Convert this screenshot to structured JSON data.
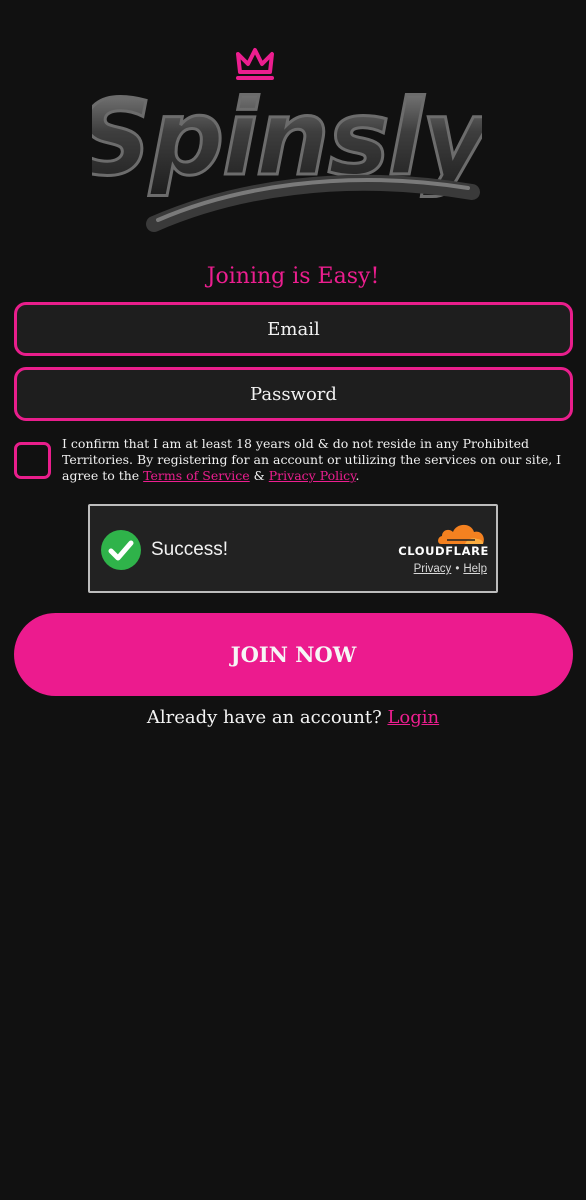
{
  "brand": {
    "logo_text": "Spinsly",
    "accent_color": "#ec1e8f"
  },
  "form": {
    "heading": "Joining is Easy!",
    "email_placeholder": "Email",
    "password_placeholder": "Password",
    "consent": {
      "checked": false,
      "text_prefix": "I confirm that I am at least 18 years old & do not reside in any Prohibited Territories. By registering for an account or utilizing the services on our site, I agree to the ",
      "terms_link": "Terms of Service",
      "joiner": " & ",
      "privacy_link": "Privacy Policy",
      "text_suffix": "."
    },
    "join_button": "JOIN NOW",
    "login_prompt": "Already have an account? ",
    "login_link": "Login"
  },
  "captcha": {
    "status": "Success!",
    "status_icon": "check-icon",
    "status_color": "#2fb34a",
    "provider": "CLOUDFLARE",
    "provider_icon": "cloudflare-cloud-icon",
    "provider_color": "#f48120",
    "privacy_link": "Privacy",
    "separator": "•",
    "help_link": "Help"
  }
}
